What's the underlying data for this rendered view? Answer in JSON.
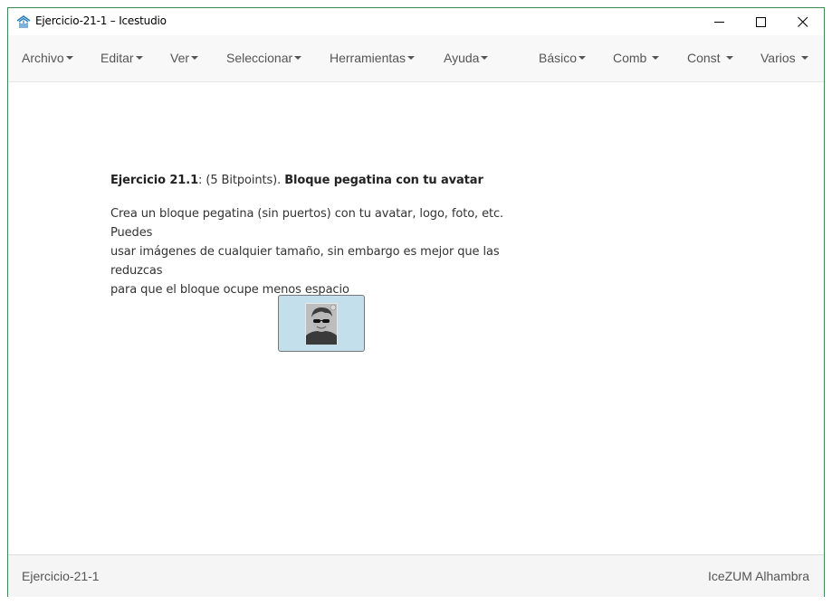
{
  "window": {
    "title": "Ejercicio-21-1 – Icestudio",
    "icons": {
      "app": "icestudio-icon",
      "minimize": "minimize-icon",
      "maximize": "maximize-icon",
      "close": "close-icon"
    }
  },
  "menubar": {
    "left_items": [
      {
        "label": "Archivo"
      },
      {
        "label": "Editar"
      },
      {
        "label": "Ver"
      },
      {
        "label": "Seleccionar"
      },
      {
        "label": "Herramientas"
      },
      {
        "label": "Ayuda"
      }
    ],
    "right_items": [
      {
        "label": "Básico"
      },
      {
        "label": "Comb"
      },
      {
        "label": "Const"
      },
      {
        "label": "Varios"
      }
    ]
  },
  "info_block": {
    "heading_bold": "Ejercicio 21.1",
    "heading_normal": ": (5 Bitpoints). ",
    "heading_bold2": "Bloque pegatina con tu avatar",
    "body_lines": [
      "Crea un bloque pegatina (sin puertos) con tu avatar, logo, foto, etc. Puedes",
      "usar imágenes de cualquier tamaño, sin embargo es mejor que las reduzcas",
      "para que el bloque ocupe menos espacio"
    ]
  },
  "sticker_block": {
    "image": "avatar-photo"
  },
  "footer": {
    "left": "Ejercicio-21-1",
    "right": "IceZUM Alhambra"
  },
  "colors": {
    "window_border": "#3d8a51",
    "menubar_bg": "#f8f8f8",
    "menu_text": "#555555",
    "sticker_bg": "#c2dfeb",
    "footer_bg": "#f5f5f5"
  }
}
